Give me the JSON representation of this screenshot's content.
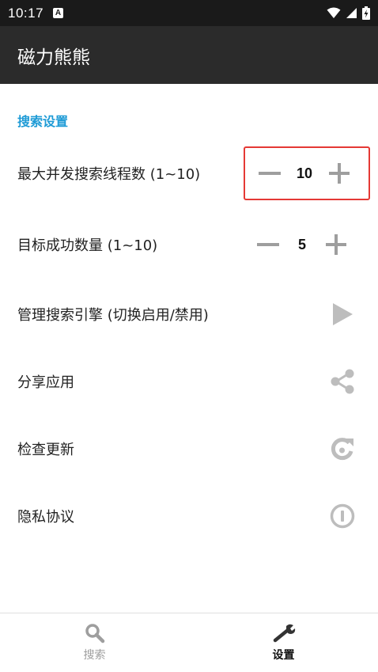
{
  "status_bar": {
    "time": "10:17",
    "notification_letter": "A"
  },
  "app_bar": {
    "title": "磁力熊熊"
  },
  "settings": {
    "section_title": "搜索设置",
    "thread_count": {
      "label": "最大并发搜索线程数 (1~10)",
      "value": "10"
    },
    "target_count": {
      "label": "目标成功数量 (1~10)",
      "value": "5"
    },
    "items": [
      {
        "label": "管理搜索引擎 (切换启用/禁用)",
        "icon": "play-arrow-icon"
      },
      {
        "label": "分享应用",
        "icon": "share-icon"
      },
      {
        "label": "检查更新",
        "icon": "refresh-icon"
      },
      {
        "label": "隐私协议",
        "icon": "info-icon"
      }
    ]
  },
  "bottom_nav": {
    "search_label": "搜索",
    "settings_label": "设置"
  },
  "colors": {
    "accent": "#1e9bd6",
    "app_bar": "#2b2b2b",
    "status_bar": "#1a1a1a",
    "highlight": "#e53935",
    "icon_gray": "#bdbdbd",
    "stepper_gray": "#9e9e9e"
  }
}
